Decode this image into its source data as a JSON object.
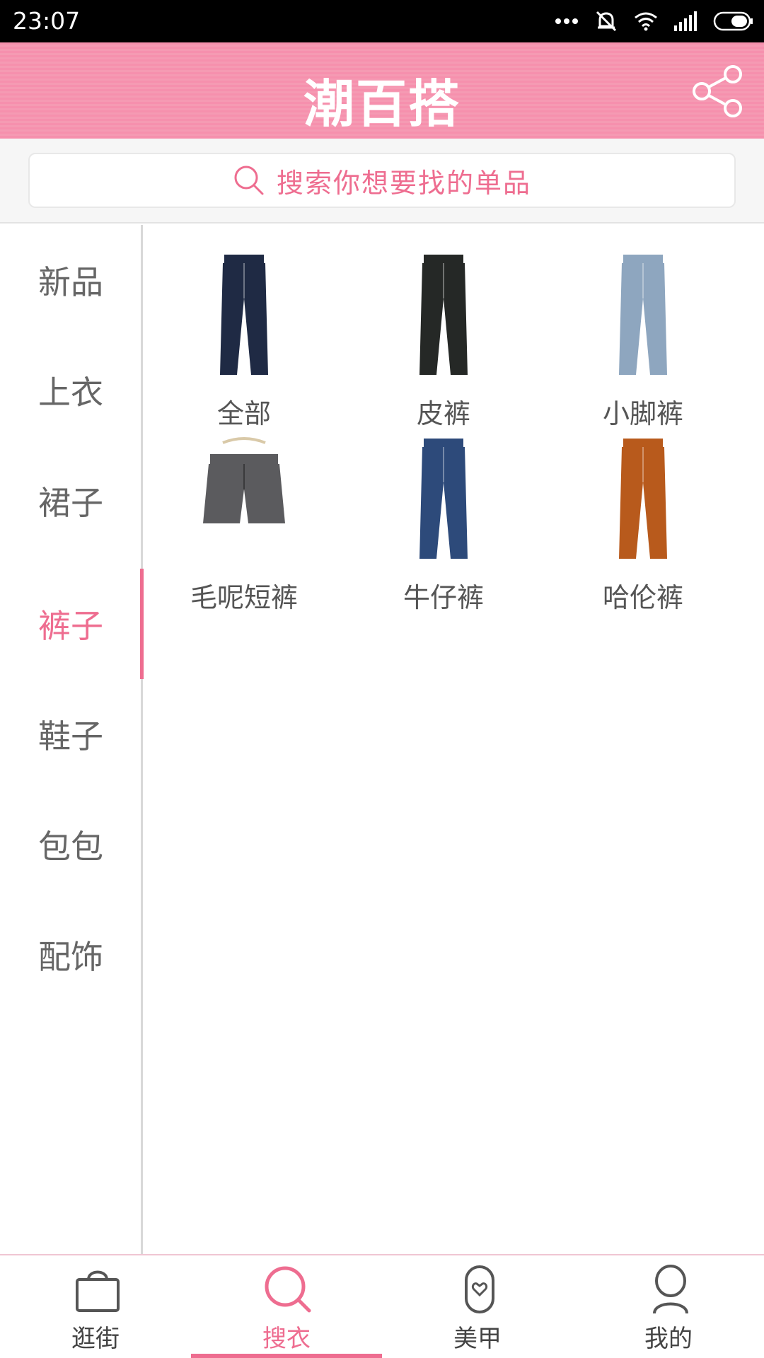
{
  "status_bar": {
    "time": "23:07"
  },
  "header": {
    "title": "潮百搭"
  },
  "search": {
    "placeholder": "搜索你想要找的单品"
  },
  "sidebar": {
    "active_index": 3,
    "items": [
      {
        "label": "新品"
      },
      {
        "label": "上衣"
      },
      {
        "label": "裙子"
      },
      {
        "label": "裤子"
      },
      {
        "label": "鞋子"
      },
      {
        "label": "包包"
      },
      {
        "label": "配饰"
      }
    ]
  },
  "grid": {
    "items": [
      {
        "label": "全部",
        "color": "#1f2a44",
        "kind": "pants"
      },
      {
        "label": "皮裤",
        "color": "#252826",
        "kind": "pants"
      },
      {
        "label": "小脚裤",
        "color": "#8ea6bf",
        "kind": "pants"
      },
      {
        "label": "毛呢短裤",
        "color": "#5b5b5e",
        "kind": "shorts"
      },
      {
        "label": "牛仔裤",
        "color": "#2d4a7a",
        "kind": "pants"
      },
      {
        "label": "哈伦裤",
        "color": "#b85a1c",
        "kind": "pants"
      }
    ]
  },
  "bottom_nav": {
    "active_index": 1,
    "items": [
      {
        "label": "逛街",
        "icon": "shopping-bag-icon"
      },
      {
        "label": "搜衣",
        "icon": "search-icon"
      },
      {
        "label": "美甲",
        "icon": "nail-icon"
      },
      {
        "label": "我的",
        "icon": "user-icon"
      }
    ]
  },
  "colors": {
    "accent": "#ee6d90",
    "header": "#f690ad"
  }
}
